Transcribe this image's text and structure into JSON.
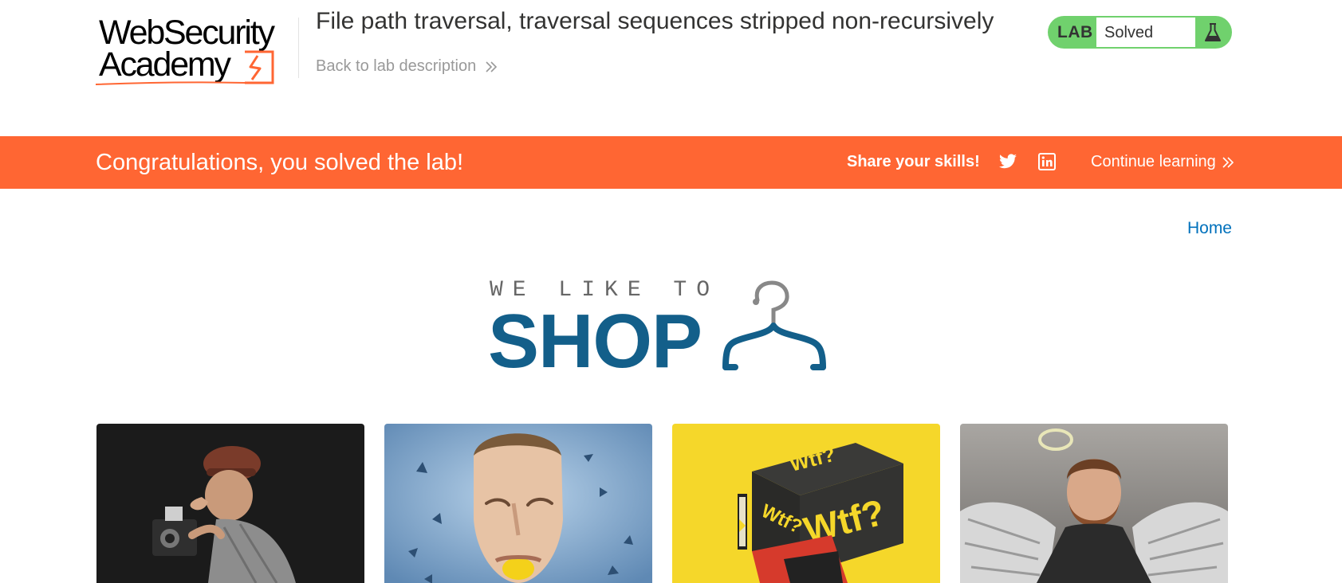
{
  "header": {
    "logo_line1": "WebSecurity",
    "logo_line2": "Academy",
    "lab_title": "File path traversal, traversal sequences stripped non-recursively",
    "back_link": "Back to lab description",
    "lab_badge": "LAB",
    "lab_status": "Solved",
    "icons": [
      "flask-icon",
      "chevron-double-right-icon"
    ]
  },
  "banner": {
    "message": "Congratulations, you solved the lab!",
    "share_label": "Share your skills!",
    "continue_label": "Continue learning",
    "icons": [
      "twitter-icon",
      "linkedin-icon",
      "chevron-double-right-icon"
    ]
  },
  "nav": {
    "home": "Home"
  },
  "hero": {
    "tagline": "WE LIKE TO",
    "title": "SHOP",
    "icon": "hanger-icon"
  },
  "products": [
    {
      "image": "photographer-figurine-image"
    },
    {
      "image": "man-biting-lemon-image"
    },
    {
      "image": "wtf-party-game-box-image"
    },
    {
      "image": "angel-wings-man-image"
    }
  ],
  "colors": {
    "banner": "#ff6633",
    "lab_solved": "#70d16d",
    "shop_blue": "#135f8a",
    "link_blue": "#0071bc"
  }
}
